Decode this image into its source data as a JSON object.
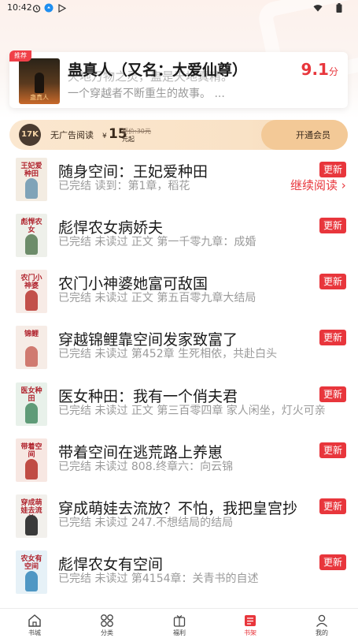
{
  "status_bar": {
    "time": "10:42"
  },
  "recommend": {
    "tag": "推荐",
    "cover_text": "蛊真人",
    "faded_line": "天地万物之灵，蛊是天地真精。",
    "title": "蛊真人（又名：大爱仙尊）",
    "description": "一个穿越者不断重生的故事。 ...",
    "score": "9.1",
    "score_unit": "分"
  },
  "vip": {
    "logo_text": "17K",
    "label": "无广告阅读",
    "currency": "¥",
    "price": "15",
    "original_price": "原价:30元",
    "price_unit": "元起",
    "cta": "开通会员"
  },
  "books": [
    {
      "title": "随身空间：王妃爱种田",
      "info": "已完结 读到：第1章，稻花",
      "badge": "更新",
      "continue": "继续阅读 ›",
      "cover_text": "王妃爱种田",
      "cover_bg": "#f3ece2",
      "cover_fig": "#7fa3b8"
    },
    {
      "title": "彪悍农女病娇夫",
      "info": "已完结 未读过 正文 第一千零九章：成婚",
      "badge": "更新",
      "cover_text": "彪悍农女",
      "cover_bg": "#eef0ea",
      "cover_fig": "#6d8c6a"
    },
    {
      "title": "农门小神婆她富可敌国",
      "info": "已完结 未读过 正文 第五百零九章大结局",
      "badge": "更新",
      "cover_text": "农门小神婆",
      "cover_bg": "#f7ebe6",
      "cover_fig": "#c2504a"
    },
    {
      "title": "穿越锦鲤靠空间发家致富了",
      "info": "已完结 未读过 第452章 生死相依，共赴白头",
      "badge": "更新",
      "cover_text": "锦鲤",
      "cover_bg": "#f6ece6",
      "cover_fig": "#d07a70"
    },
    {
      "title": "医女种田：我有一个俏夫君",
      "info": "已完结 未读过 正文 第三百零四章 家人闲坐，灯火可亲",
      "badge": "更新",
      "cover_text": "医女种田",
      "cover_bg": "#e8f1ea",
      "cover_fig": "#5f9b78"
    },
    {
      "title": "带着空间在逃荒路上养崽",
      "info": "已完结 未读过 808.终章六：向云锦",
      "badge": "更新",
      "cover_text": "带着空间",
      "cover_bg": "#f7e7e2",
      "cover_fig": "#c04c44"
    },
    {
      "title": "穿成萌娃去流放？不怕，我把皇宫抄",
      "info": "已完结 未读过 247.不想结局的结局",
      "badge": "更新",
      "cover_text": "穿成萌娃去流放",
      "cover_bg": "#f2f0ec",
      "cover_fig": "#3a3a3a"
    },
    {
      "title": "彪悍农女有空间",
      "info": "已完结 未读过 第4154章：关青书的自述",
      "badge": "更新",
      "cover_text": "农女有空间",
      "cover_bg": "#e6f1f7",
      "cover_fig": "#4f97c4"
    }
  ],
  "nav": [
    {
      "label": "书城",
      "icon": "home-icon"
    },
    {
      "label": "分类",
      "icon": "category-icon"
    },
    {
      "label": "福利",
      "icon": "gift-icon"
    },
    {
      "label": "书架",
      "icon": "bookshelf-icon",
      "active": true
    },
    {
      "label": "我的",
      "icon": "profile-icon"
    }
  ],
  "colors": {
    "accent": "#e8363c",
    "vip_bg": "#fbe7cf"
  }
}
